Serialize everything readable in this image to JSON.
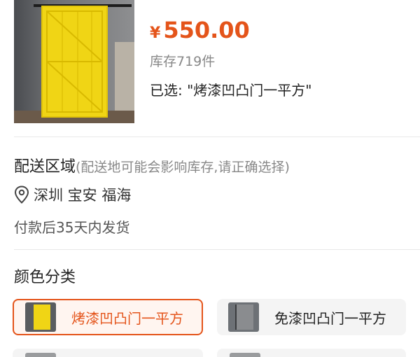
{
  "product": {
    "currency": "¥",
    "price": "550.00",
    "stock": "库存719件",
    "selected": "已选: \"烤漆凹凸门一平方\""
  },
  "delivery": {
    "title": "配送区域",
    "hint": "(配送地可能会影响库存,请正确选择)",
    "address": "深圳 宝安 福海",
    "shipping": "付款后35天内发货"
  },
  "color": {
    "title": "颜色分类",
    "options": [
      {
        "label": "烤漆凹凸门一平方",
        "selected": true
      },
      {
        "label": "免漆凹凸门一平方",
        "selected": false
      }
    ]
  },
  "colors": {
    "accent": "#e4541a",
    "door_yellow": "#f0d515"
  },
  "icons": {
    "location": "location-pin-icon"
  }
}
